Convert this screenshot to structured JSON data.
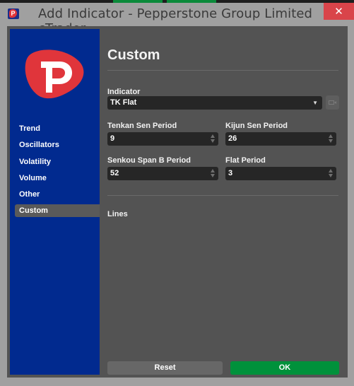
{
  "window": {
    "title": "Add Indicator - Pepperstone Group Limited cTrader",
    "close_label": "✕",
    "app_icon_letter": "P"
  },
  "sidebar": {
    "items": [
      {
        "label": "Trend",
        "active": false
      },
      {
        "label": "Oscillators",
        "active": false
      },
      {
        "label": "Volatility",
        "active": false
      },
      {
        "label": "Volume",
        "active": false
      },
      {
        "label": "Other",
        "active": false
      },
      {
        "label": "Custom",
        "active": true
      }
    ]
  },
  "content": {
    "heading": "Custom",
    "indicator": {
      "label": "Indicator",
      "value": "TK Flat"
    },
    "params": [
      {
        "label": "Tenkan Sen Period",
        "value": "9"
      },
      {
        "label": "Kijun Sen Period",
        "value": "26"
      },
      {
        "label": "Senkou Span B Period",
        "value": "52"
      },
      {
        "label": "Flat Period",
        "value": "3"
      }
    ],
    "lines_label": "Lines"
  },
  "buttons": {
    "reset": "Reset",
    "ok": "OK"
  },
  "colors": {
    "sidebar_bg": "#012a8f",
    "brand_red": "#e0353b",
    "ok_green": "#00913b",
    "close_red": "#d9444a"
  }
}
